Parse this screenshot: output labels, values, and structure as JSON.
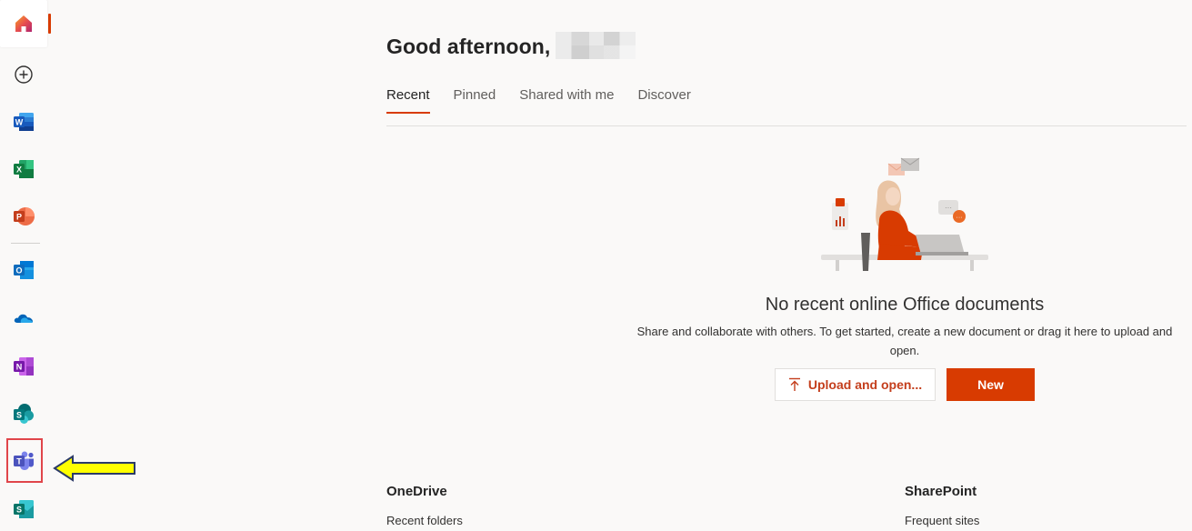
{
  "rail": {
    "items": [
      {
        "name": "home-icon",
        "label": ""
      },
      {
        "name": "create-icon",
        "label": ""
      },
      {
        "name": "word-icon",
        "letter": "W"
      },
      {
        "name": "excel-icon",
        "letter": "X"
      },
      {
        "name": "powerpoint-icon",
        "letter": "P"
      },
      {
        "name": "outlook-icon",
        "letter": "O"
      },
      {
        "name": "onedrive-icon",
        "letter": ""
      },
      {
        "name": "onenote-icon",
        "letter": "N"
      },
      {
        "name": "sharepoint-icon",
        "letter": "S"
      },
      {
        "name": "teams-icon",
        "letter": "T"
      },
      {
        "name": "sway-icon",
        "letter": "S"
      }
    ]
  },
  "header": {
    "greeting": "Good afternoon,"
  },
  "tabs": [
    "Recent",
    "Pinned",
    "Shared with me",
    "Discover"
  ],
  "empty_state": {
    "title": "No recent online Office documents",
    "description": "Share and collaborate with others. To get started, create a new document or drag it here to upload and open.",
    "upload_label": "Upload and open...",
    "new_label": "New"
  },
  "sections": {
    "onedrive": {
      "title": "OneDrive",
      "subtitle": "Recent folders"
    },
    "sharepoint": {
      "title": "SharePoint",
      "subtitle": "Frequent sites"
    }
  },
  "colors": {
    "accent": "#d83b01",
    "word": "#185abd",
    "excel": "#107c41",
    "powerpoint": "#c43e1c",
    "outlook": "#0f6cbd",
    "onedrive": "#0364b8",
    "onenote": "#7719aa",
    "sharepoint": "#03787c",
    "teams": "#5b5fc7",
    "highlight": "#e0454a",
    "arrow": "#ffff00"
  }
}
